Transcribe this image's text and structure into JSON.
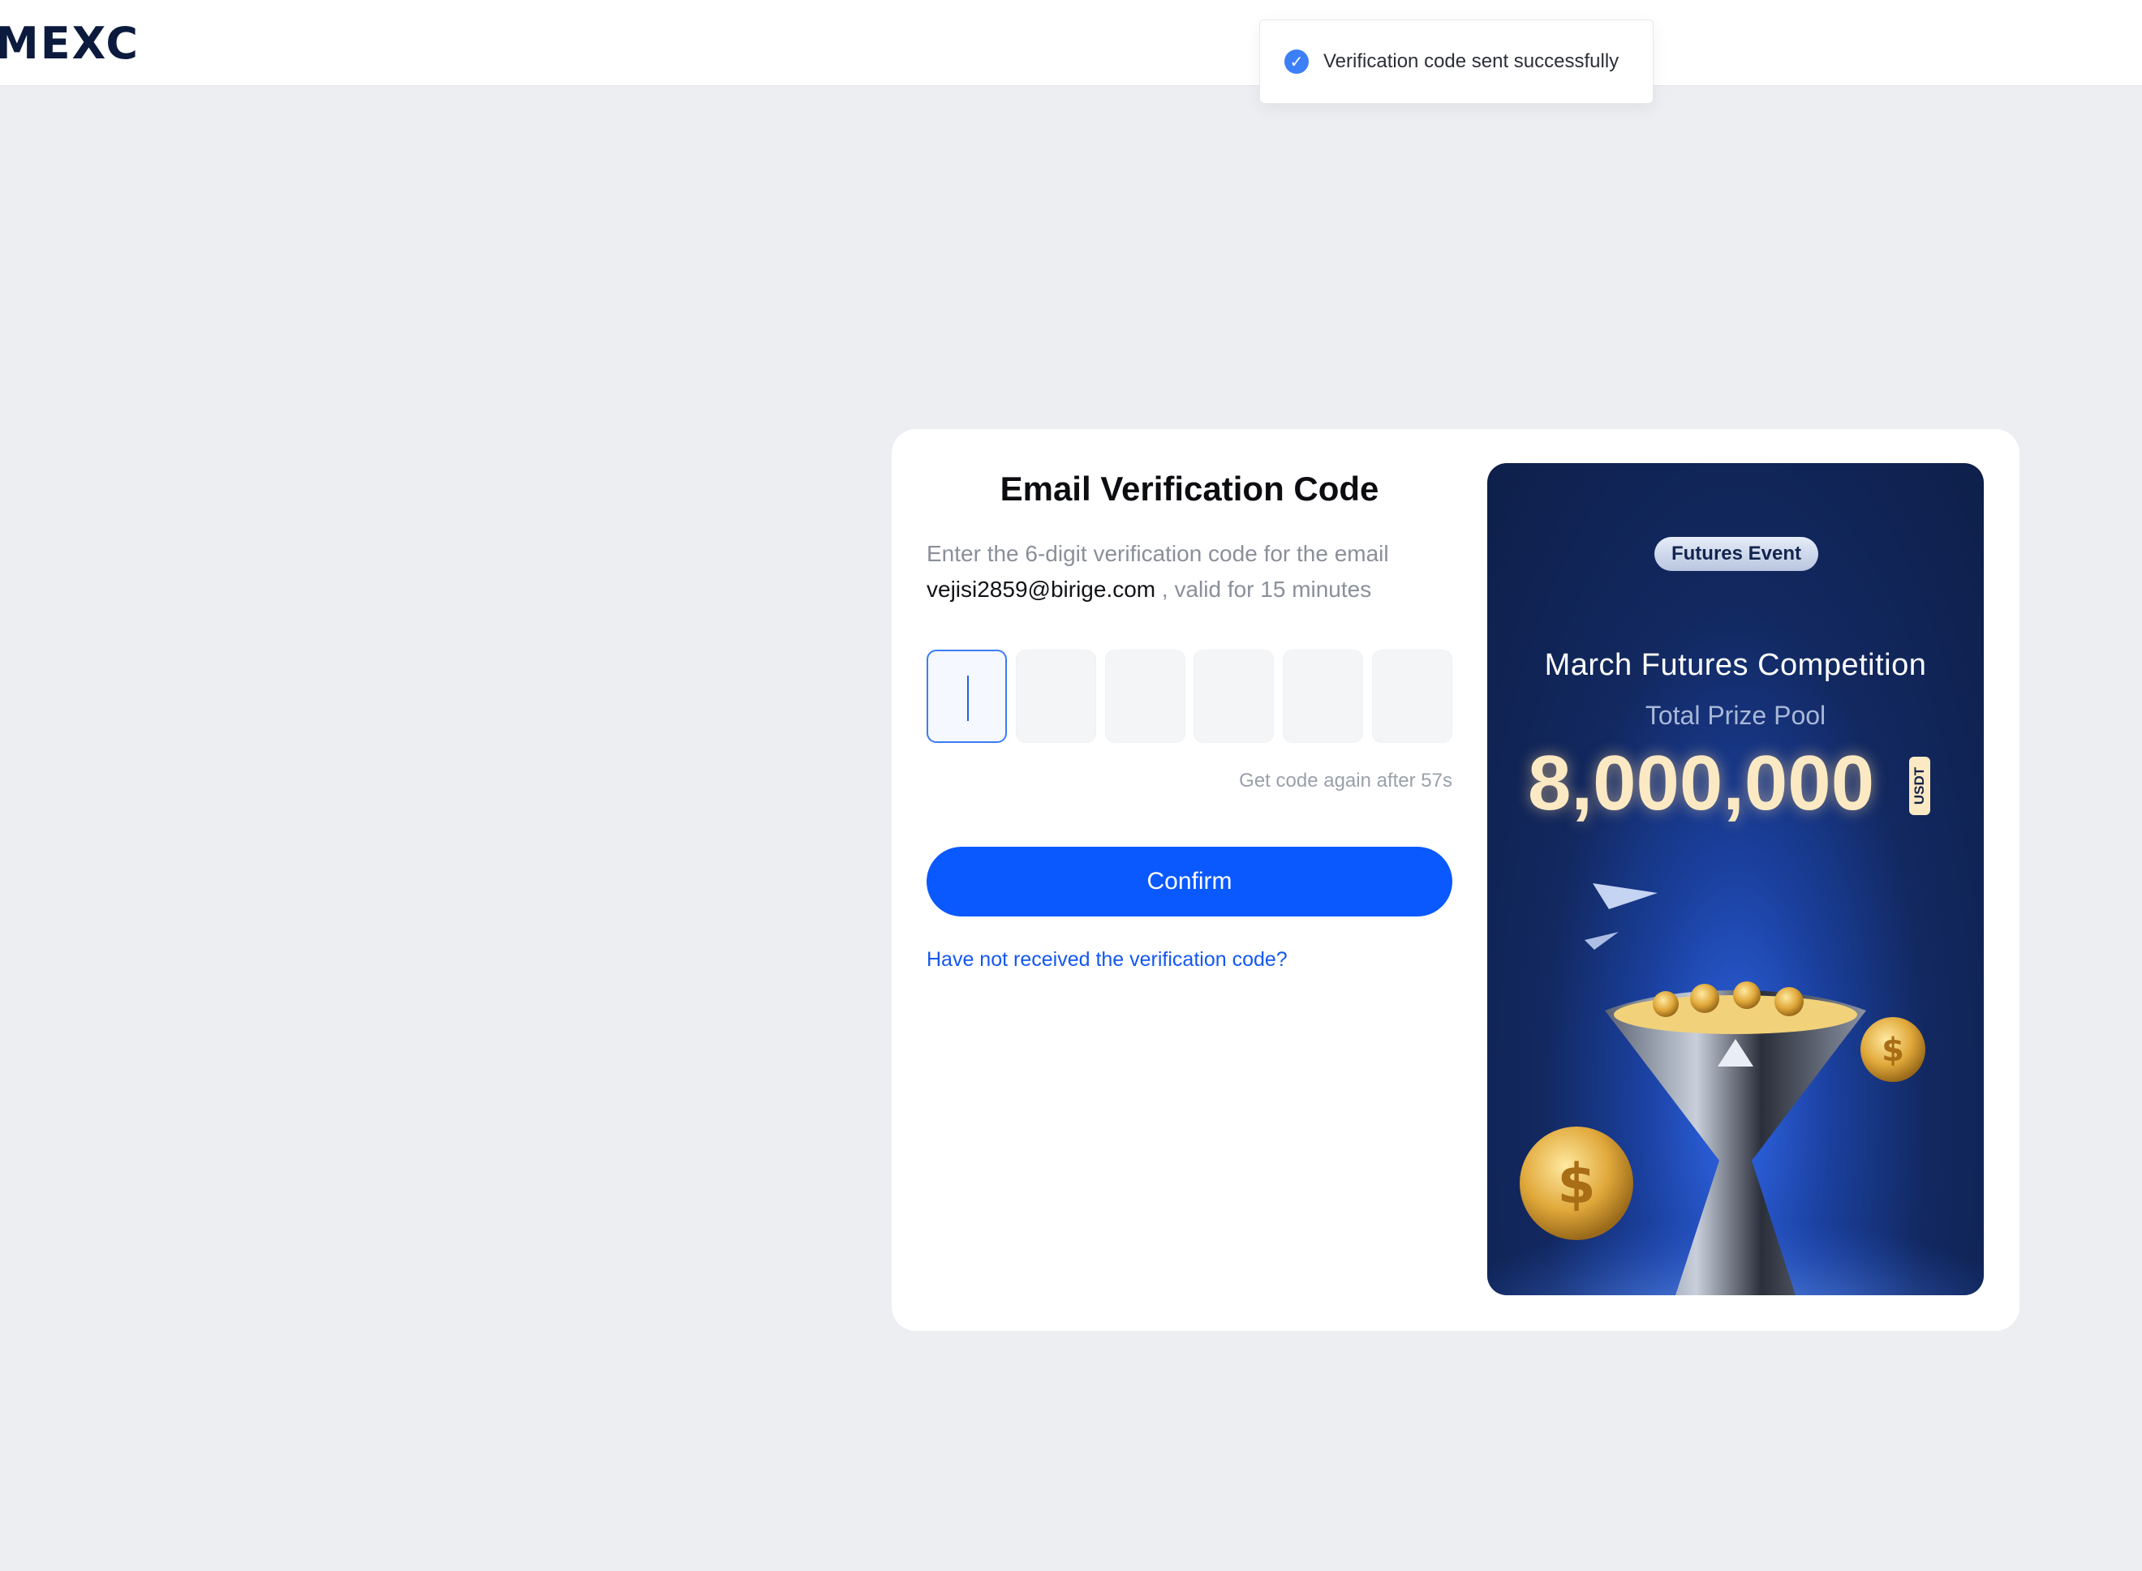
{
  "header": {
    "logo_text": "MEXC"
  },
  "toast": {
    "icon": "check-circle-icon",
    "message": "Verification code sent successfully",
    "icon_color": "#3d7ff7"
  },
  "form": {
    "title": "Email Verification Code",
    "instruction_prefix": "Enter the 6-digit verification code for the email",
    "email": "vejisi2859@birige.com",
    "instruction_suffix": ", valid for 15 minutes",
    "code_digits": [
      "",
      "",
      "",
      "",
      "",
      ""
    ],
    "resend_text": "Get code again after 57s",
    "confirm_label": "Confirm",
    "not_received_link": "Have not received the verification code?"
  },
  "promo": {
    "badge": "Futures Event",
    "title": "March Futures Competition",
    "subtitle": "Total Prize Pool",
    "amount": "8,000,000",
    "unit": "USDT"
  },
  "colors": {
    "primary": "#0a59ff",
    "link": "#1457f0",
    "promo_bg": "#0e1f4a",
    "prize_gold": "#fbe9c3"
  }
}
